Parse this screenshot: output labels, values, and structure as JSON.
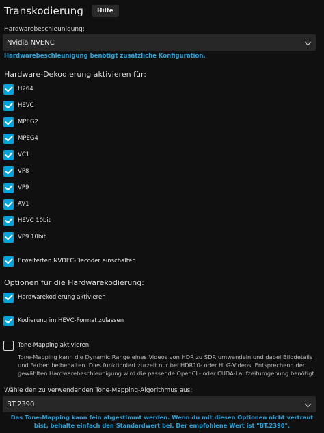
{
  "header": {
    "title": "Transkodierung",
    "help_label": "Hilfe"
  },
  "hw_accel": {
    "label": "Hardwarebeschleunigung:",
    "value": "Nvidia NVENC",
    "hint": "Hardwarebeschleunigung benötigt zusätzliche Konfiguration."
  },
  "decoding": {
    "title": "Hardware-Dekodierung aktivieren für:",
    "items": [
      {
        "label": "H264",
        "checked": true
      },
      {
        "label": "HEVC",
        "checked": true
      },
      {
        "label": "MPEG2",
        "checked": true
      },
      {
        "label": "MPEG4",
        "checked": true
      },
      {
        "label": "VC1",
        "checked": true
      },
      {
        "label": "VP8",
        "checked": true
      },
      {
        "label": "VP9",
        "checked": true
      },
      {
        "label": "AV1",
        "checked": true
      },
      {
        "label": "HEVC 10bit",
        "checked": true
      },
      {
        "label": "VP9 10bit",
        "checked": true
      }
    ],
    "nvdec_label": "Erweiterten NVDEC-Decoder einschalten"
  },
  "encoding": {
    "title": "Optionen für die Hardwarekodierung:",
    "hw_encoding_label": "Hardwarekodierung aktivieren",
    "hevc_label": "Kodierung im HEVC-Format zulassen"
  },
  "tone_mapping": {
    "label": "Tone-Mapping aktivieren",
    "description": "Tone-Mapping kann die Dynamic Range eines Videos von HDR zu SDR umwandeln und dabei Bilddetails und Farben beibehalten. Dies funktioniert zurzeit nur bei HDR10- oder HLG-Videos. Entsprechend der gewählten Hardwarebeschleunigung wird die passende OpenCL- oder CUDA-Laufzeitumgebung benötigt.",
    "algorithm_label": "Wähle den zu verwendenden Tone-Mapping-Algorithmus aus:",
    "algorithm_value": "BT.2390",
    "algorithm_hint": "Das Tone-Mapping kann fein abgestimmt werden. Wenn du mit diesen Optionen nicht vertraut bist, behalte einfach den Standardwert bei. Der empfohlene Wert ist \"BT.2390\"."
  },
  "colors": {
    "accent": "#00a4dc",
    "hint": "#2aa3d8",
    "background": "#101010"
  }
}
